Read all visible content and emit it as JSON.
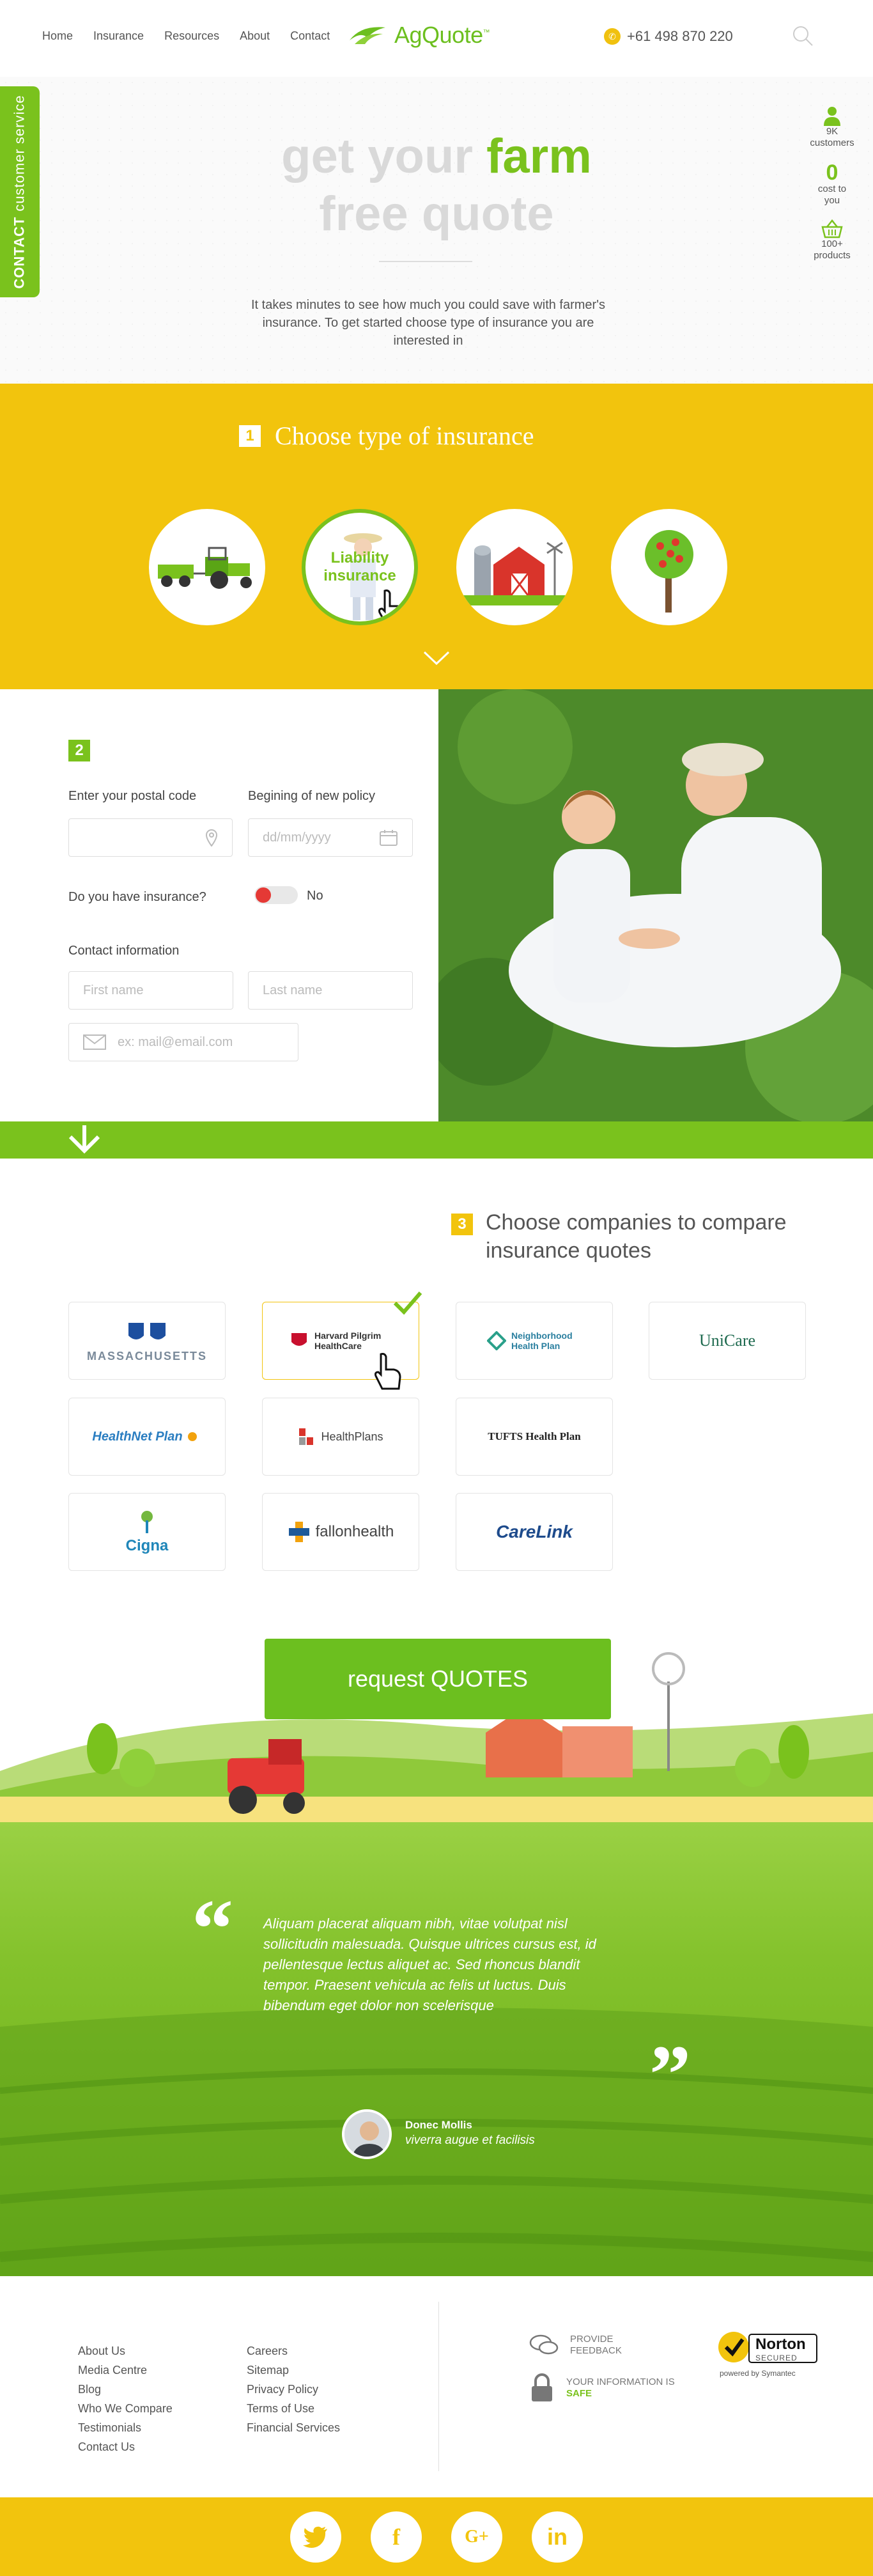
{
  "header": {
    "nav": [
      "Home",
      "Insurance",
      "Resources",
      "About",
      "Contact"
    ],
    "logo": "AgQuote",
    "logo_tm": "™",
    "phone": "+61 498 870 220"
  },
  "sidebar_tab": {
    "bold": "CONTACT",
    "rest": "customer service"
  },
  "hero": {
    "title_1a": "get your",
    "title_1b": "farm",
    "title_2": "free quote",
    "description": "It takes minutes to see how much you could save with farmer's insurance. To get started choose type of insurance you are interested in"
  },
  "stats": [
    {
      "value": "9K",
      "label": "customers"
    },
    {
      "value": "0",
      "label": "cost to you"
    },
    {
      "value": "100+",
      "label": "products"
    }
  ],
  "step1": {
    "number": "1",
    "title": "Choose type of insurance",
    "active_label": "Liability insurance"
  },
  "step2": {
    "number": "2",
    "postal_label": "Enter your postal code",
    "policy_label": "Begining of new policy",
    "date_placeholder": "dd/mm/yyyy",
    "have_insurance_label": "Do you have insurance?",
    "toggle_value": "No",
    "contact_label": "Contact information",
    "first_name_placeholder": "First name",
    "last_name_placeholder": "Last name",
    "email_placeholder": "ex: mail@email.com"
  },
  "step3": {
    "number": "3",
    "title": "Choose companies to compare insurance quotes",
    "companies": [
      "MASSACHUSETTS",
      "Harvard Pilgrim HealthCare",
      "Neighborhood Health Plan",
      "UniCare",
      "HealthNet Plan",
      "HealthPlans",
      "TUFTS Health Plan",
      "Cigna",
      "fallonhealth",
      "CareLink"
    ],
    "selected": "Harvard Pilgrim HealthCare"
  },
  "cta": {
    "label": "request QUOTES"
  },
  "testimonial": {
    "quote": "Aliquam placerat aliquam nibh, vitae volutpat nisl sollicitudin malesuada. Quisque ultrices cursus est, id pellentesque lectus aliquet ac. Sed rhoncus blandit tempor. Praesent vehicula ac felis ut luctus. Duis bibendum eget dolor non scelerisque",
    "author": "Donec Mollis",
    "role": "viverra augue et facilisis"
  },
  "footer": {
    "col1": [
      "About Us",
      "Media Centre",
      "Blog",
      "Who We Compare",
      "Testimonials",
      "Contact Us"
    ],
    "col2": [
      "Careers",
      "Sitemap",
      "Privacy Policy",
      "Terms of Use",
      "Financial Services"
    ],
    "feedback": "PROVIDE FEEDBACK",
    "safe_prefix": "YOUR INFORMATION IS",
    "safe_word": "SAFE",
    "norton": "Norton",
    "norton_secured": "SECURED",
    "norton_powered": "powered by Symantec"
  },
  "social": [
    "twitter-icon",
    "facebook-icon",
    "google-plus-icon",
    "linkedin-icon"
  ],
  "colors": {
    "green": "#7ac21d",
    "yellow": "#f2c40d"
  }
}
